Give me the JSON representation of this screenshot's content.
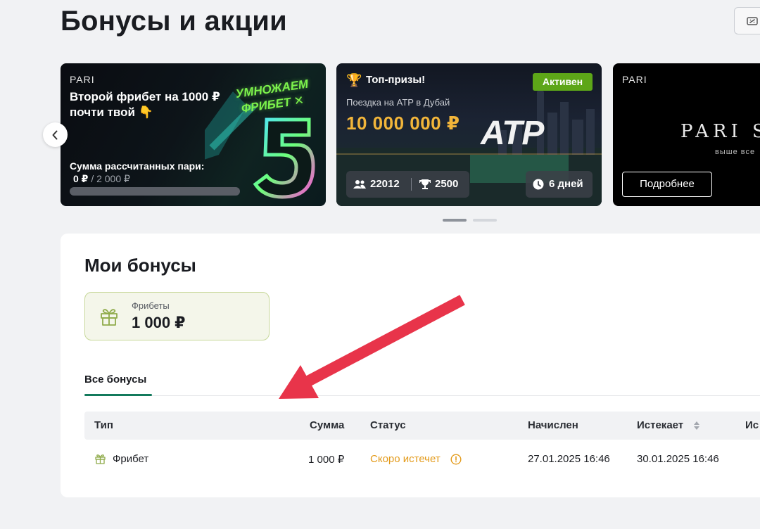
{
  "page": {
    "title": "Бонусы и акции"
  },
  "carousel": {
    "cards": [
      {
        "brand": "PARI",
        "title": "Второй фрибет на 1000 ₽ почти твой 👇",
        "promo_text": "УМНОЖАЕМ ФРИБЕТ ✕",
        "promo_number": "5",
        "sum_label": "Сумма рассчитанных пари:",
        "sum_current": "0 ₽",
        "sum_separator": "/",
        "sum_total": "2 000 ₽",
        "progress": 0
      },
      {
        "title": "Топ-призы!",
        "badge": "Активен",
        "subtitle": "Поездка на ATP в Дубай",
        "prize": "10 000 000 ₽",
        "logo_text": "ATP",
        "participants": "22012",
        "prizes_count": "2500",
        "days_left": "6 дней"
      },
      {
        "brand": "PARI",
        "logo_text": "PARI SÈC",
        "tagline": "выше все",
        "button_label": "Подробнее"
      }
    ],
    "active_slide": 1,
    "slide_count": 2
  },
  "my_bonuses": {
    "title": "Мои бонусы",
    "summary": {
      "label": "Фрибеты",
      "value": "1 000 ₽"
    },
    "tabs": [
      "Все бонусы"
    ],
    "table": {
      "columns": [
        "Тип",
        "Сумма",
        "Статус",
        "Начислен",
        "Истекает",
        "Ис"
      ],
      "rows": [
        {
          "type": "Фрибет",
          "amount": "1 000 ₽",
          "status": "Скоро истечет",
          "accrued": "27.01.2025 16:46",
          "expires": "30.01.2025 16:46"
        }
      ]
    }
  },
  "colors": {
    "accent_green": "#137a5c",
    "badge_green": "#5da618",
    "status_warning": "#e39a1a",
    "prize_gold": "#f2b53a",
    "annotation_arrow": "#e8344a"
  },
  "icons": {
    "corner_button": "promo-code-icon",
    "prev": "chevron-left-icon",
    "trophy": "trophy-icon",
    "participants": "users-icon",
    "prizes": "cup-icon",
    "clock": "clock-icon",
    "gift": "gift-icon",
    "warning": "info-circle-icon",
    "sort": "sort-icon"
  }
}
